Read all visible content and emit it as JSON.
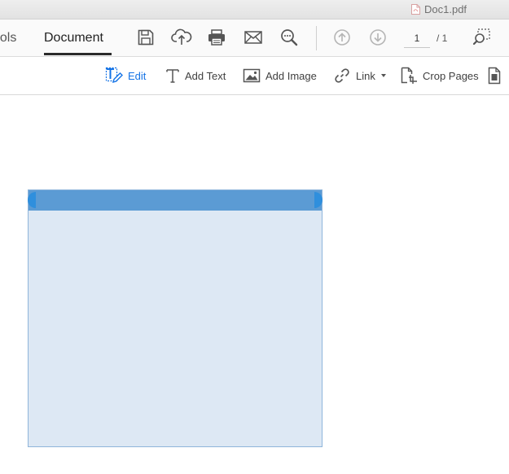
{
  "window": {
    "title": "Doc1.pdf",
    "file_icon": "pdf-file-icon"
  },
  "toolbar": {
    "tabs": [
      {
        "label": "ools",
        "active": false
      },
      {
        "label": "Document",
        "active": true
      }
    ],
    "buttons": [
      {
        "name": "save-button",
        "icon": "floppy-disk-icon"
      },
      {
        "name": "upload-cloud-button",
        "icon": "cloud-upload-icon"
      },
      {
        "name": "print-button",
        "icon": "printer-icon"
      },
      {
        "name": "email-button",
        "icon": "envelope-icon"
      },
      {
        "name": "zoom-out-button",
        "icon": "magnifier-minus-icon"
      },
      {
        "name": "previous-page-button",
        "icon": "arrow-up-circle-icon"
      },
      {
        "name": "next-page-button",
        "icon": "arrow-down-circle-icon"
      },
      {
        "name": "marquee-zoom-button",
        "icon": "marquee-zoom-icon"
      }
    ],
    "page": {
      "current": "1",
      "total": "/ 1"
    }
  },
  "edit_toolbar": {
    "items": [
      {
        "label": "Edit",
        "icon": "edit-text-icon",
        "active": true
      },
      {
        "label": "Add Text",
        "icon": "text-t-icon",
        "active": false
      },
      {
        "label": "Add Image",
        "icon": "image-icon",
        "active": false
      },
      {
        "label": "Link",
        "icon": "link-chain-icon",
        "active": false,
        "dropdown": true
      },
      {
        "label": "Crop Pages",
        "icon": "crop-page-icon",
        "active": false
      },
      {
        "label": "",
        "icon": "page-icon",
        "active": false
      }
    ]
  },
  "colors": {
    "accent": "#1473e6",
    "textbox_fill": "#dde8f4",
    "textbox_header": "#5b9bd4",
    "textbox_handle": "#2f8fdd",
    "icon_gray": "#555555",
    "icon_disabled": "#b5b5b5"
  }
}
